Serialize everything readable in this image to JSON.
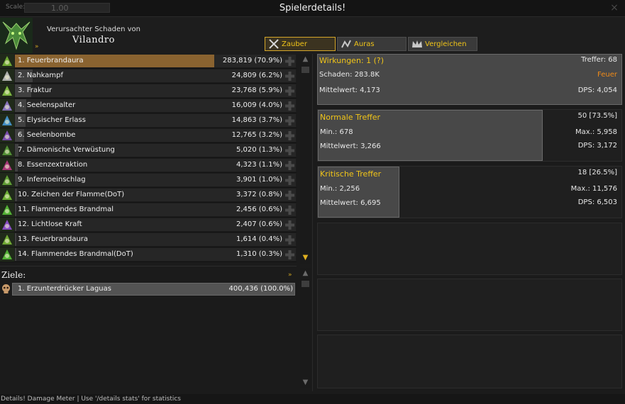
{
  "window": {
    "title": "Spielerdetails!",
    "scale_label": "Scale:",
    "scale_value": "1.00",
    "close_symbol": "×"
  },
  "header": {
    "caused_by": "Verursachter Schaden von",
    "player_name": "Vilandro",
    "expand_symbol": "»"
  },
  "tabs": [
    {
      "label": "Zauber",
      "icon": "crossed-swords-icon",
      "active": true
    },
    {
      "label": "Auras",
      "icon": "aura-icon",
      "active": false
    },
    {
      "label": "Vergleichen",
      "icon": "crown-icon",
      "active": false
    }
  ],
  "spells": [
    {
      "label": "1. Feuerbrandaura",
      "value": "283,819 (70.9%)",
      "percent": 70.9,
      "icon_color": "#7fbf3a"
    },
    {
      "label": "2. Nahkampf",
      "value": "24,809 (6.2%)",
      "percent": 6.2,
      "icon_color": "#c8c8c8"
    },
    {
      "label": "3. Fraktur",
      "value": "23,768 (5.9%)",
      "percent": 5.9,
      "icon_color": "#8fd04a"
    },
    {
      "label": "4. Seelenspalter",
      "value": "16,009 (4.0%)",
      "percent": 4.0,
      "icon_color": "#9a7fd8"
    },
    {
      "label": "5. Elysischer Erlass",
      "value": "14,863 (3.7%)",
      "percent": 3.7,
      "icon_color": "#4aa0e0"
    },
    {
      "label": "6. Seelenbombe",
      "value": "12,765 (3.2%)",
      "percent": 3.2,
      "icon_color": "#8a52c8"
    },
    {
      "label": "7. Dämonische Verwüstung",
      "value": "5,020 (1.3%)",
      "percent": 1.3,
      "icon_color": "#5aa03a"
    },
    {
      "label": "8. Essenzextraktion",
      "value": "4,323 (1.1%)",
      "percent": 1.1,
      "icon_color": "#c03a8a"
    },
    {
      "label": "9. Infernoeinschlag",
      "value": "3,901 (1.0%)",
      "percent": 1.0,
      "icon_color": "#6ab03a"
    },
    {
      "label": "10. Zeichen der Flamme(DoT)",
      "value": "3,372 (0.8%)",
      "percent": 0.8,
      "icon_color": "#7ac83a"
    },
    {
      "label": "11. Flammendes Brandmal",
      "value": "2,456 (0.6%)",
      "percent": 0.6,
      "icon_color": "#5cc83a"
    },
    {
      "label": "12. Lichtlose Kraft",
      "value": "2,407 (0.6%)",
      "percent": 0.6,
      "icon_color": "#9a52e0"
    },
    {
      "label": "13. Feuerbrandaura",
      "value": "1,614 (0.4%)",
      "percent": 0.4,
      "icon_color": "#7fbf3a"
    },
    {
      "label": "14. Flammendes Brandmal(DoT)",
      "value": "1,310 (0.3%)",
      "percent": 0.3,
      "icon_color": "#5cc83a"
    }
  ],
  "targets": {
    "title": "Ziele:",
    "expand_symbol": "»",
    "items": [
      {
        "label": "1. Erzunterdrücker Laguas",
        "value": "400,436 (100.0%)"
      }
    ]
  },
  "details": {
    "summary": {
      "title": "Wirkungen: 1 (?)",
      "hits": "Treffer: 68",
      "damage": "Schaden: 283.8K",
      "school": "Feuer",
      "average": "Mittelwert: 4,173",
      "dps": "DPS: 4,054"
    },
    "normal": {
      "title": "Normale Treffer",
      "count": "50 [73.5%]",
      "min": "Min.: 678",
      "max": "Max.: 5,958",
      "average": "Mittelwert: 3,266",
      "dps": "DPS: 3,172"
    },
    "critical": {
      "title": "Kritische Treffer",
      "count": "18 [26.5%]",
      "min": "Min.: 2,256",
      "max": "Max.: 11,576",
      "average": "Mittelwert: 6,695",
      "dps": "DPS: 6,503"
    }
  },
  "status_bar": "Details! Damage Meter | Use '/details stats' for statistics",
  "colors": {
    "accent_gold": "#f0c419",
    "top_bar": "#8a6330",
    "fire_school": "#f08a18"
  }
}
